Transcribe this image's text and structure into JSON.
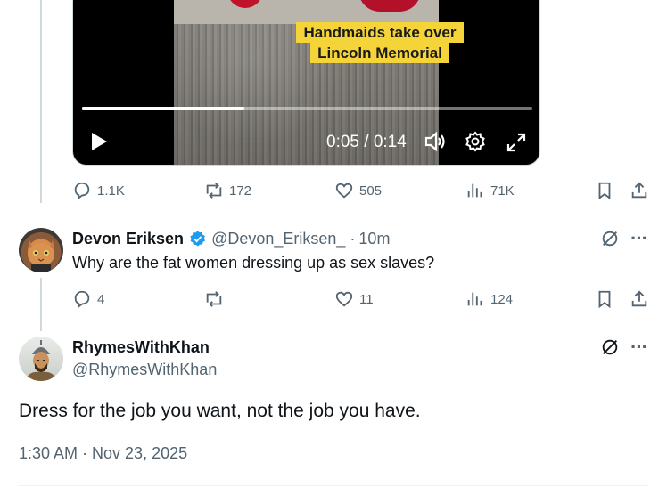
{
  "video": {
    "caption_line1": "Handmaids take over",
    "caption_line2": "Lincoln Memorial",
    "time": "0:05 / 0:14",
    "progress": 0.36
  },
  "main_tweet_actions": {
    "replies": "1.1K",
    "reposts": "172",
    "likes": "505",
    "views": "71K"
  },
  "reply": {
    "name": "Devon Eriksen",
    "handle": "@Devon_Eriksen_",
    "separator": "·",
    "time": "10m",
    "text": "Why are the fat women dressing up as sex slaves?",
    "replies": "4",
    "reposts": "",
    "likes": "11",
    "views": "124"
  },
  "focused": {
    "name": "RhymesWithKhan",
    "handle": "@RhymesWithKhan",
    "text": "Dress for the job you want, not the job you have.",
    "timestamp": "1:30 AM · Nov 23, 2025"
  },
  "colors": {
    "verified": "#1d9bf0",
    "muted": "#536471",
    "caption_bg": "#f5d43a"
  }
}
